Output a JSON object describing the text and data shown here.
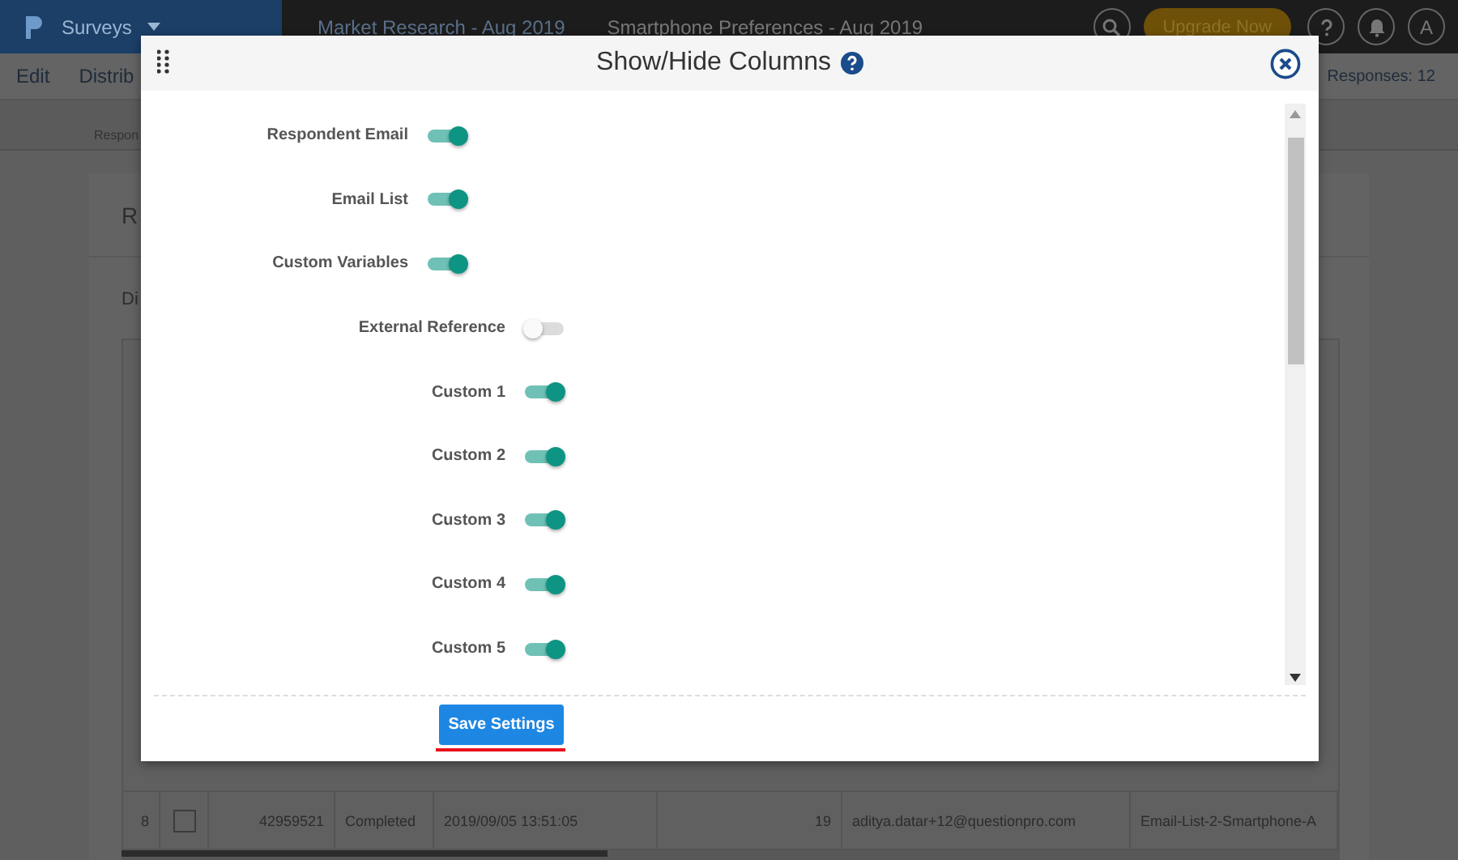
{
  "topbar": {
    "product": "Surveys",
    "breadcrumb": "Market Research - Aug 2019",
    "survey": "Smartphone Preferences - Aug 2019",
    "upgrade": "Upgrade Now",
    "avatar": "A"
  },
  "menu": {
    "items": [
      "Edit",
      "Distrib"
    ],
    "responses": "Responses: 12"
  },
  "toolbar": {
    "items": [
      "Respon"
    ]
  },
  "card": {
    "title": "R",
    "subtitle": "Di"
  },
  "table": {
    "rows": [
      {
        "cells": [
          "8",
          "42959521",
          "Completed",
          "2019/09/05 13:51:05",
          "19",
          "aditya.datar+12@questionpro.com",
          "Email-List-2-Smartphone-A"
        ],
        "checked": false
      }
    ]
  },
  "dialog": {
    "title": "Show/Hide Columns",
    "groups": [
      {
        "items": [
          {
            "label": "Respondent Email",
            "on": true
          },
          {
            "label": "Email List",
            "on": true
          },
          {
            "label": "Custom Variables",
            "on": true
          }
        ]
      },
      {
        "items": [
          {
            "label": "External Reference",
            "on": false
          },
          {
            "label": "Custom 1",
            "on": true
          },
          {
            "label": "Custom 2",
            "on": true
          },
          {
            "label": "Custom 3",
            "on": true
          },
          {
            "label": "Custom 4",
            "on": true
          },
          {
            "label": "Custom 5",
            "on": true
          }
        ]
      }
    ],
    "save": "Save Settings"
  }
}
